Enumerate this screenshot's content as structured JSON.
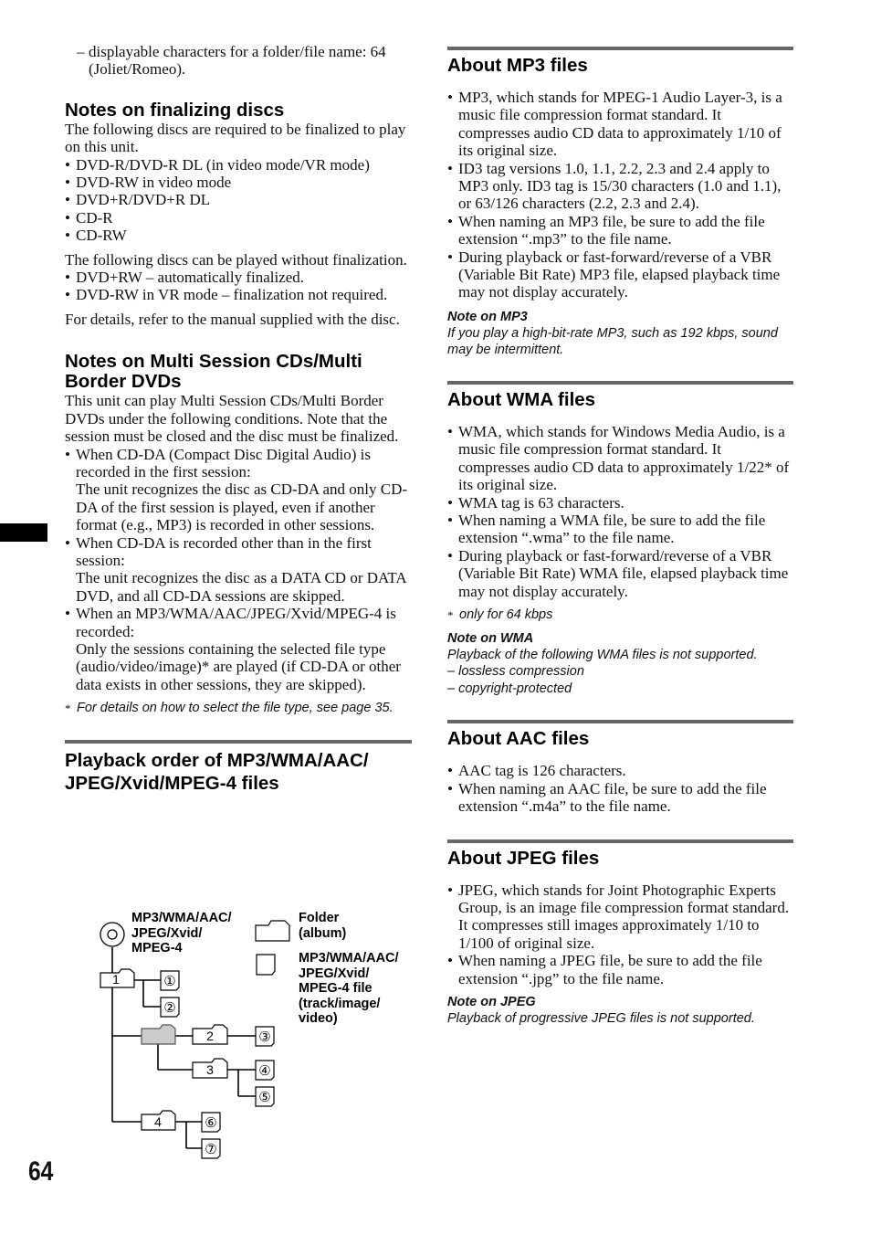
{
  "page": {
    "number": "64",
    "colors": {
      "rule": "#666666",
      "text": "#111111",
      "side_tab": "#000000",
      "root_folder_fill": "#cccccc"
    }
  },
  "left": {
    "intro_dash": "displayable characters for a folder/file name: 64 (Joliet/Romeo).",
    "finalizing": {
      "title": "Notes on finalizing discs",
      "intro": "The following discs are required to be finalized to play on this unit.",
      "required": [
        "DVD-R/DVD-R DL (in video mode/VR mode)",
        "DVD-RW in video mode",
        "DVD+R/DVD+R DL",
        "CD-R",
        "CD-RW"
      ],
      "without_intro": "The following discs can be played without finalization.",
      "without": [
        "DVD+RW – automatically finalized.",
        "DVD-RW in VR mode – finalization not required."
      ],
      "details": "For details, refer to the manual supplied with the disc."
    },
    "multisession": {
      "title": "Notes on Multi Session CDs/Multi Border DVDs",
      "intro": "This unit can play Multi Session CDs/Multi Border DVDs under the following conditions. Note that the session must be closed and the disc must be finalized.",
      "items": [
        {
          "lead": "When CD-DA (Compact Disc Digital Audio) is recorded in the first session:",
          "body": "The unit recognizes the disc as CD-DA and only CD-DA of the first session is played, even if another format (e.g., MP3) is recorded in other sessions."
        },
        {
          "lead": "When CD-DA is recorded other than in the first session:",
          "body": "The unit recognizes the disc as a DATA CD or DATA DVD, and all CD-DA sessions are skipped."
        },
        {
          "lead": "When an MP3/WMA/AAC/JPEG/Xvid/MPEG-4 is recorded:",
          "body": "Only the sessions containing the selected file type (audio/video/image)* are played (if CD-DA or other data exists in other sessions, they are skipped)."
        }
      ],
      "footnote": "For details on how to select the file type, see page 35."
    },
    "playback": {
      "title": "Playback order of MP3/WMA/AAC/ JPEG/Xvid/MPEG-4 files",
      "diagram": {
        "disc_label": "MP3/WMA/AAC/ JPEG/Xvid/ MPEG-4",
        "legend_folder": "Folder (album)",
        "legend_file": "MP3/WMA/AAC/ JPEG/Xvid/ MPEG-4 file (track/image/ video)",
        "folders": [
          "1",
          "2",
          "3",
          "4"
        ],
        "tracks": [
          "①",
          "②",
          "③",
          "④",
          "⑤",
          "⑥",
          "⑦"
        ]
      }
    }
  },
  "right": {
    "mp3": {
      "title": "About MP3 files",
      "items": [
        "MP3, which stands for MPEG-1 Audio Layer-3, is a music file compression format standard. It compresses audio CD data to approximately 1/10 of its original size.",
        "ID3 tag versions 1.0, 1.1, 2.2, 2.3 and 2.4 apply to MP3 only. ID3 tag is 15/30 characters (1.0 and 1.1), or 63/126 characters (2.2, 2.3 and 2.4).",
        "When naming an MP3 file, be sure to add the file extension “.mp3” to the file name.",
        "During playback or fast-forward/reverse of a VBR (Variable Bit Rate) MP3 file, elapsed playback time may not display accurately."
      ],
      "note_title": "Note on MP3",
      "note": "If you play a high-bit-rate MP3, such as 192 kbps, sound may be intermittent."
    },
    "wma": {
      "title": "About WMA files",
      "items": [
        "WMA, which stands for Windows Media Audio, is a music file compression format standard. It compresses audio CD data to approximately 1/22* of its original size.",
        "WMA tag is 63 characters.",
        "When naming a WMA file, be sure to add the file extension “.wma” to the file name.",
        "During playback or fast-forward/reverse of a VBR (Variable Bit Rate) WMA file, elapsed playback time may not display accurately."
      ],
      "footnote": "only for 64 kbps",
      "note_title": "Note on WMA",
      "note": "Playback of the following WMA files is not supported.",
      "note_items": [
        "lossless compression",
        "copyright-protected"
      ]
    },
    "aac": {
      "title": "About AAC files",
      "items": [
        "AAC tag is 126 characters.",
        "When naming an AAC file, be sure to add the file extension “.m4a” to the file name."
      ]
    },
    "jpeg": {
      "title": "About JPEG files",
      "items": [
        "JPEG, which stands for Joint Photographic Experts Group, is an image file compression format standard. It compresses still images approximately 1/10 to 1/100 of original size.",
        "When naming a JPEG file, be sure to add the file extension “.jpg” to the file name."
      ],
      "note_title": "Note on JPEG",
      "note": "Playback of progressive JPEG files is not supported."
    }
  }
}
